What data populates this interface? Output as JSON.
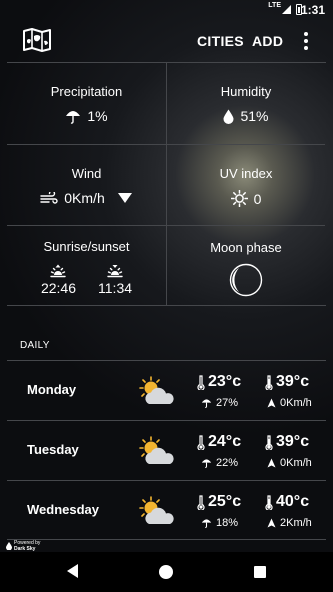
{
  "status_bar": {
    "network": "LTE",
    "time": "1:31"
  },
  "app_bar": {
    "logo_icon": "folded-map-icon",
    "cities_label": "CITIES",
    "add_label": "ADD",
    "more_icon": "more-vert-icon"
  },
  "current": {
    "precipitation": {
      "label": "Precipitation",
      "value": "1%",
      "icon": "umbrella-icon"
    },
    "humidity": {
      "label": "Humidity",
      "value": "51%",
      "icon": "water-drop-icon"
    },
    "wind": {
      "label": "Wind",
      "value": "0Km/h",
      "icon": "wind-icon",
      "direction_icon": "wind-direction-arrow-icon"
    },
    "uv": {
      "label": "UV index",
      "value": "0",
      "icon": "sun-icon"
    },
    "sun": {
      "label": "Sunrise/sunset",
      "sunrise": "22:46",
      "sunset": "11:34"
    },
    "moon": {
      "label": "Moon phase",
      "icon": "moon-phase-icon"
    }
  },
  "daily": {
    "label": "DAILY",
    "days": [
      {
        "name": "Monday",
        "t_min": "23°c",
        "t_max": "39°c",
        "precip": "27%",
        "wind": "0Km/h",
        "icon": "partly-cloudy-icon"
      },
      {
        "name": "Tuesday",
        "t_min": "24°c",
        "t_max": "39°c",
        "precip": "22%",
        "wind": "0Km/h",
        "icon": "partly-cloudy-icon"
      },
      {
        "name": "Wednesday",
        "t_min": "25°c",
        "t_max": "40°c",
        "precip": "18%",
        "wind": "2Km/h",
        "icon": "partly-cloudy-icon"
      }
    ]
  },
  "attribution": {
    "line1": "Powered by",
    "line2": "Dark Sky"
  },
  "colors": {
    "divider": "#45474b",
    "sun": "#f3b531",
    "cloud": "#d7d9dc",
    "text": "#ffffff"
  }
}
